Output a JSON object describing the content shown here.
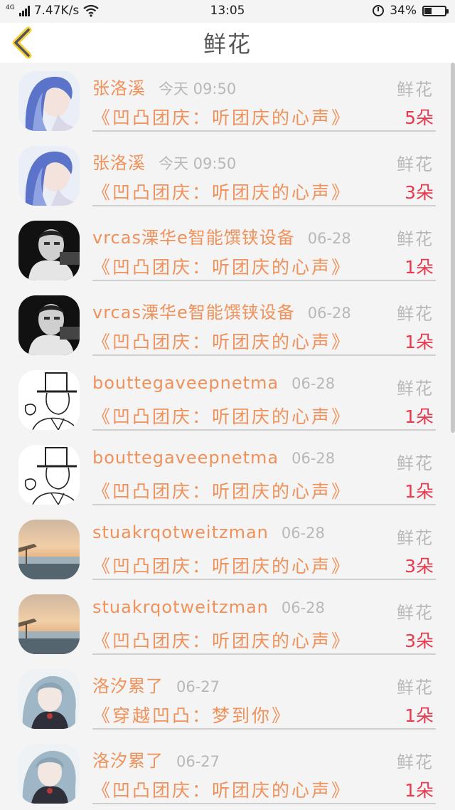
{
  "status_bar": {
    "network": "4G",
    "speed": "7.47K/s",
    "time": "13:05",
    "battery": "34%",
    "battery_level": 0.34
  },
  "header": {
    "title": "鲜花"
  },
  "colors": {
    "accent": "#f0915a",
    "count": "#e83a4f",
    "muted": "#b8b8b8"
  },
  "records": [
    {
      "name": "张洛溪",
      "time": "今天 09:50",
      "book": "《凹凸团庆：听团庆的心声》",
      "type": "鲜花",
      "count": "5朵",
      "avatar": "blue-hair-girl"
    },
    {
      "name": "张洛溪",
      "time": "今天 09:50",
      "book": "《凹凸团庆：听团庆的心声》",
      "type": "鲜花",
      "count": "3朵",
      "avatar": "blue-hair-girl"
    },
    {
      "name": "vrcas溧华e智能馔铗设备",
      "time": "06-28",
      "book": "《凹凸团庆：听团庆的心声》",
      "type": "鲜花",
      "count": "1朵",
      "avatar": "bw-photo"
    },
    {
      "name": "vrcas溧华e智能馔铗设备",
      "time": "06-28",
      "book": "《凹凸团庆：听团庆的心声》",
      "type": "鲜花",
      "count": "1朵",
      "avatar": "bw-photo"
    },
    {
      "name": "bouttegaveepnetma",
      "time": "06-28",
      "book": "《凹凸团庆：听团庆的心声》",
      "type": "鲜花",
      "count": "1朵",
      "avatar": "sketch-hat"
    },
    {
      "name": "bouttegaveepnetma",
      "time": "06-28",
      "book": "《凹凸团庆：听团庆的心声》",
      "type": "鲜花",
      "count": "1朵",
      "avatar": "sketch-hat"
    },
    {
      "name": "stuakrqotweitzman",
      "time": "06-28",
      "book": "《凹凸团庆：听团庆的心声》",
      "type": "鲜花",
      "count": "3朵",
      "avatar": "sunset-beach"
    },
    {
      "name": "stuakrqotweitzman",
      "time": "06-28",
      "book": "《凹凸团庆：听团庆的心声》",
      "type": "鲜花",
      "count": "3朵",
      "avatar": "sunset-beach"
    },
    {
      "name": "洛汐累了",
      "time": "06-27",
      "book": "《穿越凹凸：梦到你》",
      "type": "鲜花",
      "count": "1朵",
      "avatar": "anime-girl"
    },
    {
      "name": "洛汐累了",
      "time": "06-27",
      "book": "《凹凸团庆：听团庆的心声》",
      "type": "鲜花",
      "count": "1朵",
      "avatar": "anime-girl"
    }
  ]
}
